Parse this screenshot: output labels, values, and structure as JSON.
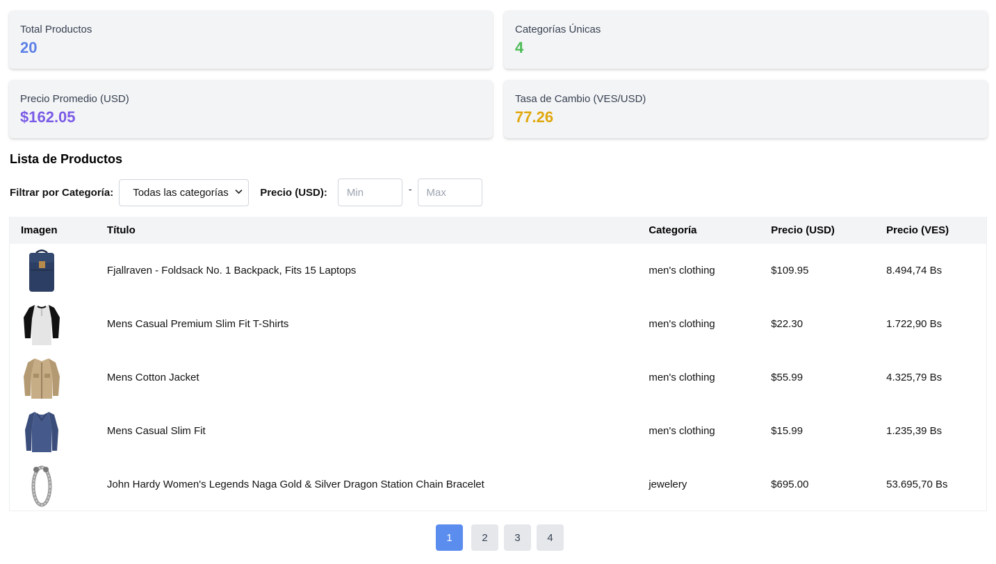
{
  "stats": [
    {
      "label": "Total Productos",
      "value": "20",
      "color": "#5b7fe6"
    },
    {
      "label": "Categorías Únicas",
      "value": "4",
      "color": "#4cbb56"
    },
    {
      "label": "Precio Promedio (USD)",
      "value": "$162.05",
      "color": "#7a5be6"
    },
    {
      "label": "Tasa de Cambio (VES/USD)",
      "value": "77.26",
      "color": "#e0a80e"
    }
  ],
  "section_title": "Lista de Productos",
  "filters": {
    "category_label": "Filtrar por Categoría:",
    "category_selected": "Todas las categorías",
    "price_label": "Precio (USD):",
    "min_placeholder": "Min",
    "max_placeholder": "Max",
    "separator": "-"
  },
  "table": {
    "headers": [
      "Imagen",
      "Título",
      "Categoría",
      "Precio (USD)",
      "Precio (VES)"
    ],
    "rows": [
      {
        "image": "backpack",
        "title": "Fjallraven - Foldsack No. 1 Backpack, Fits 15 Laptops",
        "category": "men's clothing",
        "usd": "$109.95",
        "ves": "8.494,74 Bs"
      },
      {
        "image": "raglan-tshirt",
        "title": "Mens Casual Premium Slim Fit T-Shirts",
        "category": "men's clothing",
        "usd": "$22.30",
        "ves": "1.722,90 Bs"
      },
      {
        "image": "cotton-jacket",
        "title": "Mens Cotton Jacket",
        "category": "men's clothing",
        "usd": "$55.99",
        "ves": "4.325,79 Bs"
      },
      {
        "image": "long-sleeve-shirt",
        "title": "Mens Casual Slim Fit",
        "category": "men's clothing",
        "usd": "$15.99",
        "ves": "1.235,39 Bs"
      },
      {
        "image": "dragon-bracelet",
        "title": "John Hardy Women's Legends Naga Gold & Silver Dragon Station Chain Bracelet",
        "category": "jewelery",
        "usd": "$695.00",
        "ves": "53.695,70 Bs"
      }
    ]
  },
  "pagination": {
    "pages": [
      "1",
      "2",
      "3",
      "4"
    ],
    "current": "1",
    "active_color": "#5b8def"
  }
}
